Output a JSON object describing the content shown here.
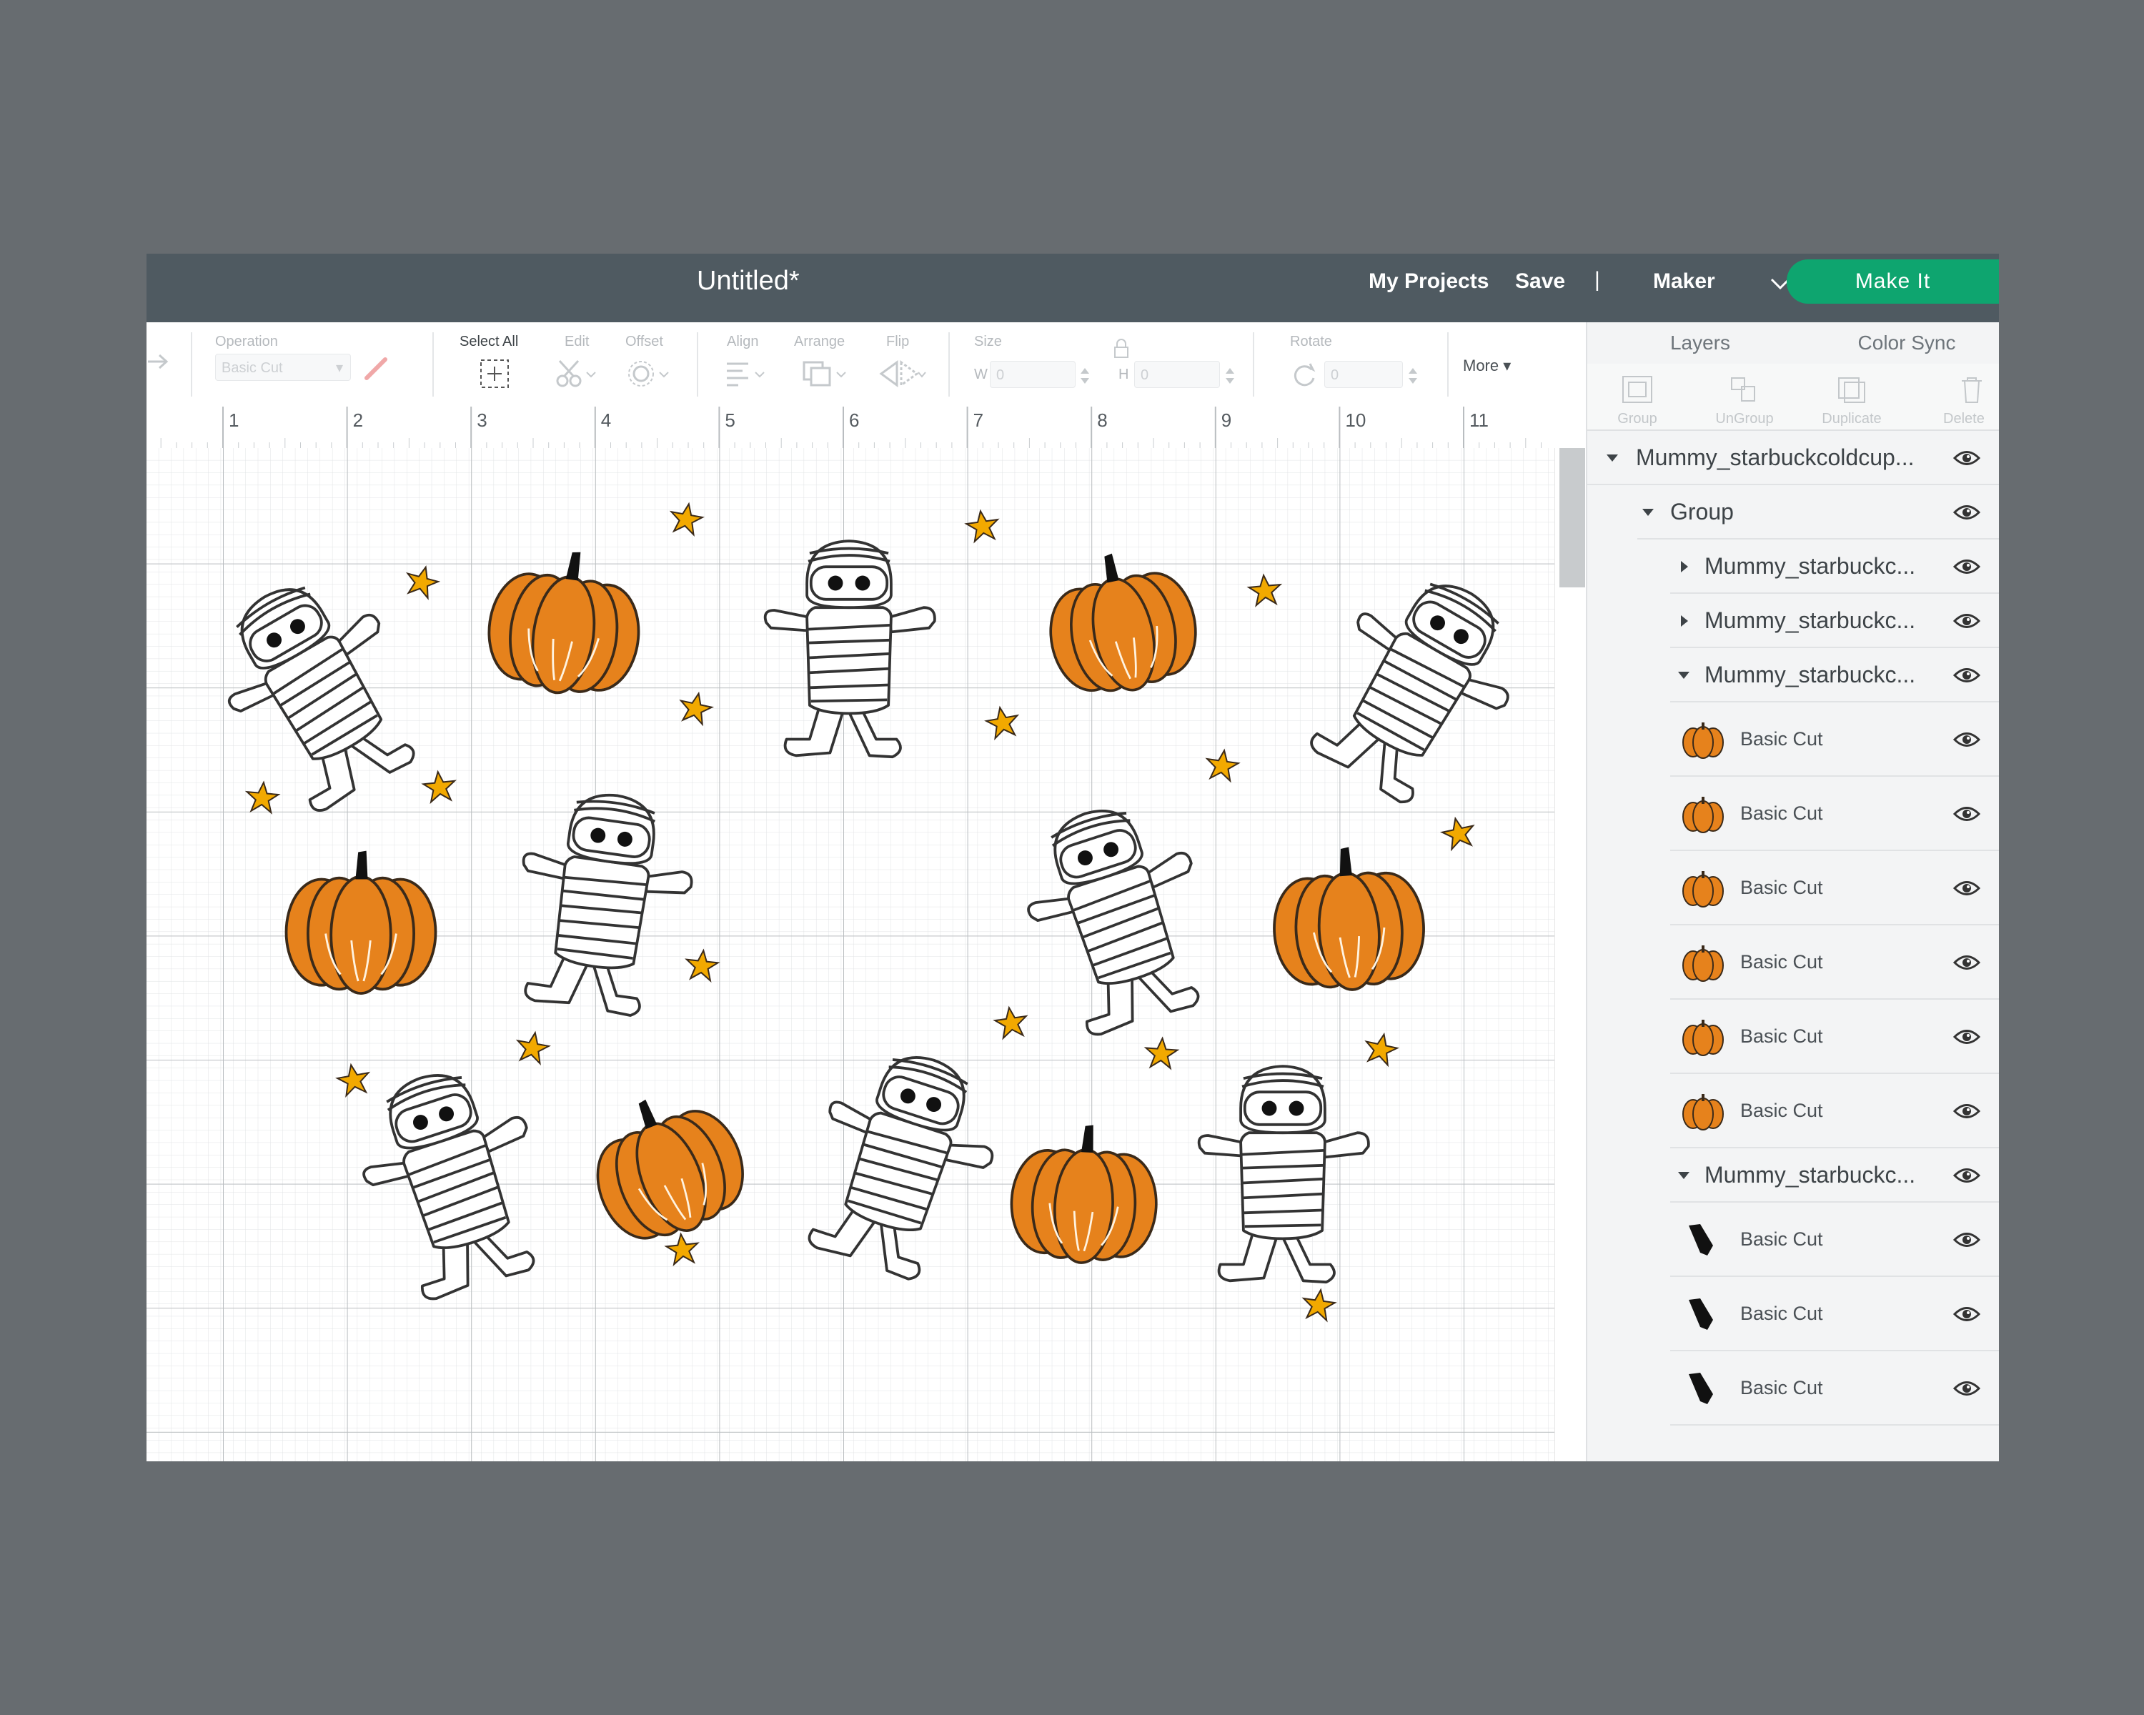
{
  "app": {
    "title": "Untitled*",
    "nav": {
      "my_projects": "My Projects",
      "save": "Save",
      "separator": "|",
      "machine": "Maker",
      "make_it": "Make It"
    },
    "colors": {
      "accent": "#0ea56f",
      "titlebar": "#4f5a61",
      "background": "#676c70",
      "pumpkin": "#e6821c",
      "star": "#f2a900"
    }
  },
  "toolbar": {
    "operation_label": "Operation",
    "operation_value": "Basic Cut",
    "select_all": "Select All",
    "edit": "Edit",
    "offset": "Offset",
    "align": "Align",
    "arrange": "Arrange",
    "flip": "Flip",
    "size": "Size",
    "w_label": "W",
    "w_value": "0",
    "h_label": "H",
    "h_value": "0",
    "rotate": "Rotate",
    "rotate_value": "0",
    "more": "More"
  },
  "ruler": {
    "ticks": [
      "1",
      "2",
      "3",
      "4",
      "5",
      "6",
      "7",
      "8",
      "9",
      "10",
      "11"
    ]
  },
  "panel": {
    "tabs": {
      "layers": "Layers",
      "color_sync": "Color Sync"
    },
    "actions": {
      "group": "Group",
      "ungroup": "UnGroup",
      "duplicate": "Duplicate",
      "delete": "Delete"
    },
    "layers": [
      {
        "name": "Mummy_starbuckcoldcup...",
        "level": 0,
        "arrow": "down"
      },
      {
        "name": "Group",
        "level": 1,
        "arrow": "down"
      },
      {
        "name": "Mummy_starbuckc...",
        "level": 2,
        "arrow": "right"
      },
      {
        "name": "Mummy_starbuckc...",
        "level": 2,
        "arrow": "right"
      },
      {
        "name": "Mummy_starbuckc...",
        "level": 2,
        "arrow": "down"
      },
      {
        "name": "Basic Cut",
        "thumb": "pumpkin-icon"
      },
      {
        "name": "Basic Cut",
        "thumb": "pumpkin-icon"
      },
      {
        "name": "Basic Cut",
        "thumb": "pumpkin-icon"
      },
      {
        "name": "Basic Cut",
        "thumb": "pumpkin-icon"
      },
      {
        "name": "Basic Cut",
        "thumb": "pumpkin-icon"
      },
      {
        "name": "Basic Cut",
        "thumb": "pumpkin-icon"
      },
      {
        "name": "Mummy_starbuckc...",
        "level": 2,
        "arrow": "down"
      },
      {
        "name": "Basic Cut",
        "thumb": "stem-icon"
      },
      {
        "name": "Basic Cut",
        "thumb": "stem-icon"
      },
      {
        "name": "Basic Cut",
        "thumb": "stem-icon"
      }
    ]
  }
}
